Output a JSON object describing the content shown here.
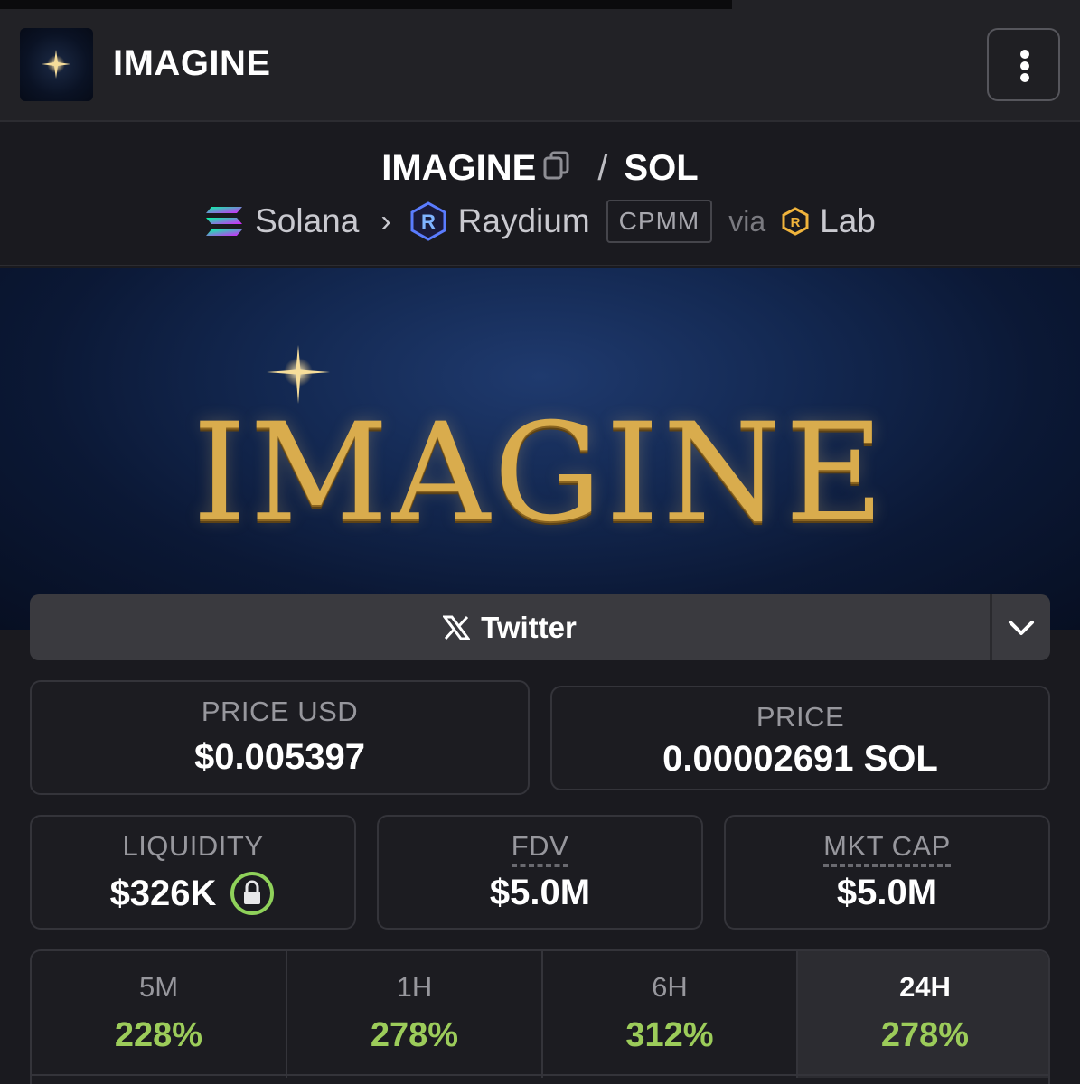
{
  "header": {
    "title": "IMAGINE",
    "logo_icon": "sparkle-star-icon",
    "menu_icon": "kebab-menu-icon"
  },
  "pair": {
    "base": "IMAGINE",
    "separator": "/",
    "quote": "SOL",
    "chain": "Solana",
    "dex": "Raydium",
    "pool_type": "CPMM",
    "via_label": "via",
    "launchpad": "Lab"
  },
  "banner": {
    "text": "IMAGINE"
  },
  "socials": {
    "primary_label": "Twitter"
  },
  "stats": {
    "price_usd_label": "PRICE USD",
    "price_usd_value": "$0.005397",
    "price_label": "PRICE",
    "price_value": "0.00002691 SOL",
    "liquidity_label": "LIQUIDITY",
    "liquidity_value": "$326K",
    "fdv_label": "FDV",
    "fdv_value": "$5.0M",
    "mktcap_label": "MKT CAP",
    "mktcap_value": "$5.0M"
  },
  "timeframes": [
    {
      "label": "5M",
      "change": "228%"
    },
    {
      "label": "1H",
      "change": "278%"
    },
    {
      "label": "6H",
      "change": "312%"
    },
    {
      "label": "24H",
      "change": "278%"
    }
  ],
  "colors": {
    "positive": "#9ccc5a",
    "accent_lock": "#8fd15a",
    "gold": "#d9ac4d"
  }
}
